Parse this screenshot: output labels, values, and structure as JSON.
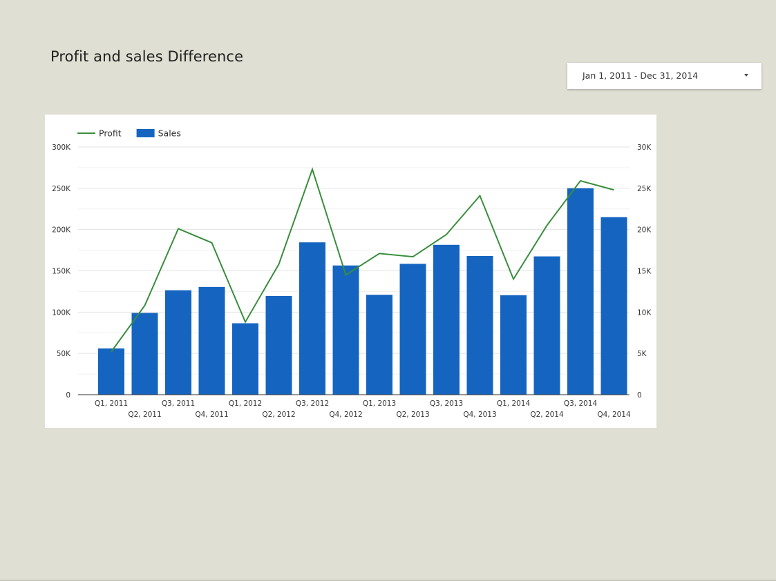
{
  "page": {
    "title": "Profit and sales Difference"
  },
  "date_filter": {
    "label": "Jan 1, 2011 - Dec 31, 2014"
  },
  "chart_data": {
    "type": "bar",
    "categories": [
      "Q1, 2011",
      "Q2, 2011",
      "Q3, 2011",
      "Q4, 2011",
      "Q1, 2012",
      "Q2, 2012",
      "Q3, 2012",
      "Q4, 2012",
      "Q1, 2013",
      "Q2, 2013",
      "Q3, 2013",
      "Q4, 2013",
      "Q1, 2014",
      "Q2, 2014",
      "Q3, 2014",
      "Q4, 2014"
    ],
    "series": [
      {
        "name": "Sales",
        "type": "bar",
        "axis": "left",
        "color": "#1565c0",
        "values": [
          56000,
          99000,
          126500,
          130500,
          86500,
          119500,
          184500,
          156500,
          121000,
          158500,
          181500,
          168000,
          120500,
          167500,
          250000,
          215000
        ]
      },
      {
        "name": "Profit",
        "type": "line",
        "axis": "right",
        "color": "#388e3c",
        "values": [
          5200,
          10800,
          20100,
          18400,
          8800,
          15800,
          27300,
          14500,
          17100,
          16700,
          19400,
          24100,
          14000,
          20500,
          25900,
          24800
        ]
      }
    ],
    "left_axis": {
      "min": 0,
      "max": 300000,
      "ticks": [
        0,
        50000,
        100000,
        150000,
        200000,
        250000,
        300000
      ],
      "tick_labels": [
        "0",
        "50K",
        "100K",
        "150K",
        "200K",
        "250K",
        "300K"
      ]
    },
    "right_axis": {
      "min": 0,
      "max": 30000,
      "ticks": [
        0,
        5000,
        10000,
        15000,
        20000,
        25000,
        30000
      ],
      "tick_labels": [
        "0",
        "5K",
        "10K",
        "15K",
        "20K",
        "25K",
        "30K"
      ]
    },
    "legend": {
      "placement": "top-left",
      "items": [
        "Profit",
        "Sales"
      ]
    },
    "grid": true,
    "minor_grid": true
  }
}
